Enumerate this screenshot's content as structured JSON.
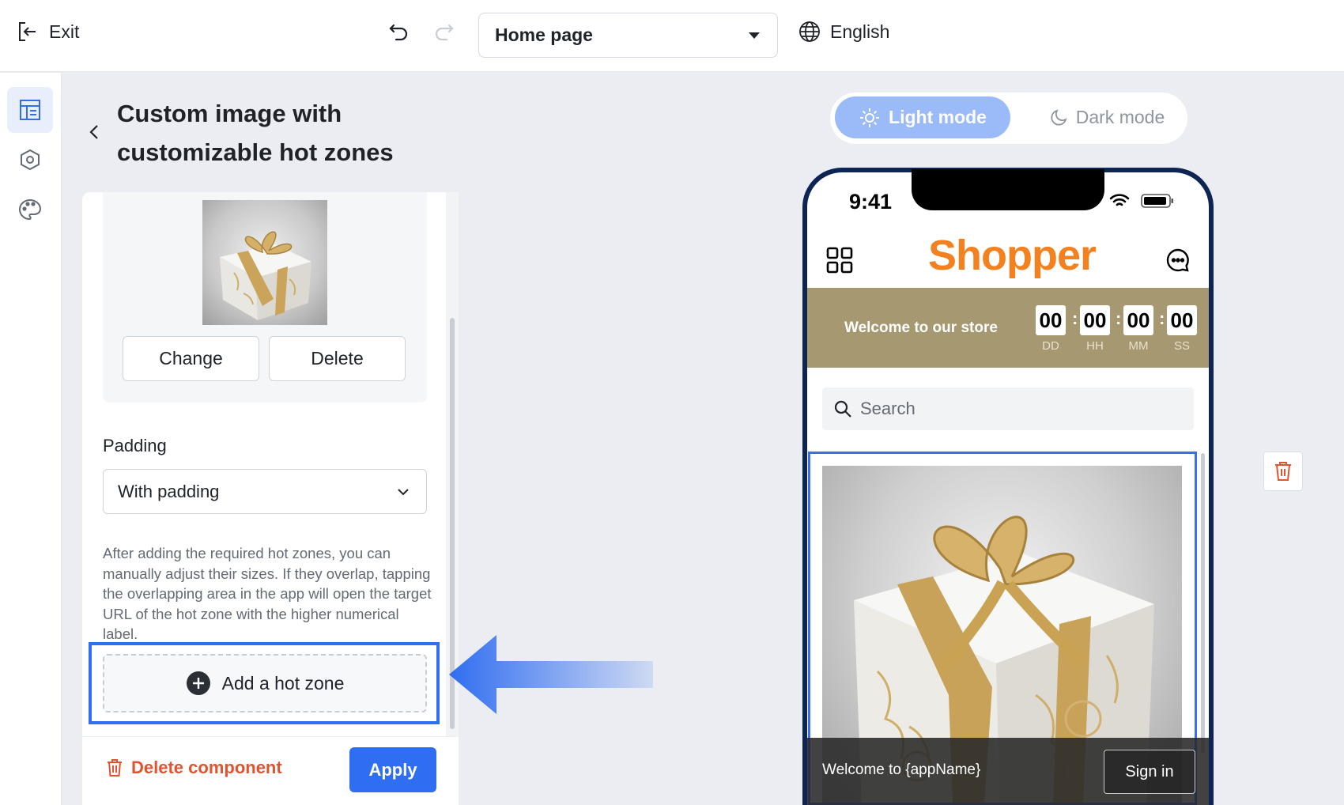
{
  "topbar": {
    "exit_label": "Exit",
    "page_selector_value": "Home page",
    "language": "English"
  },
  "rail": {
    "items": [
      "layout-icon",
      "settings-icon",
      "palette-icon"
    ]
  },
  "panel": {
    "title_line1": "Custom image with",
    "title_line2": "customizable hot zones",
    "change_label": "Change",
    "delete_label": "Delete",
    "padding_label": "Padding",
    "padding_value": "With padding",
    "help_text": "After adding the required hot zones, you can manually adjust their sizes. If they overlap, tapping the overlapping area in the app will open the target URL of the hot zone with the higher numerical label.",
    "add_hot_zone_label": "Add a hot zone",
    "delete_component_label": "Delete component",
    "apply_label": "Apply"
  },
  "preview": {
    "light_mode_label": "Light mode",
    "dark_mode_label": "Dark mode",
    "time": "9:41",
    "brand": "Shopper",
    "banner_text": "Welcome to our store",
    "countdown": [
      {
        "value": "00",
        "label": "DD"
      },
      {
        "value": "00",
        "label": "HH"
      },
      {
        "value": "00",
        "label": "MM"
      },
      {
        "value": "00",
        "label": "SS"
      }
    ],
    "search_placeholder": "Search",
    "welcome_text": "Welcome to {appName}",
    "signin_label": "Sign in"
  },
  "colors": {
    "accent": "#2f6df1",
    "brand_orange": "#f4811f",
    "banner": "#a69870",
    "danger": "#e2532f"
  }
}
